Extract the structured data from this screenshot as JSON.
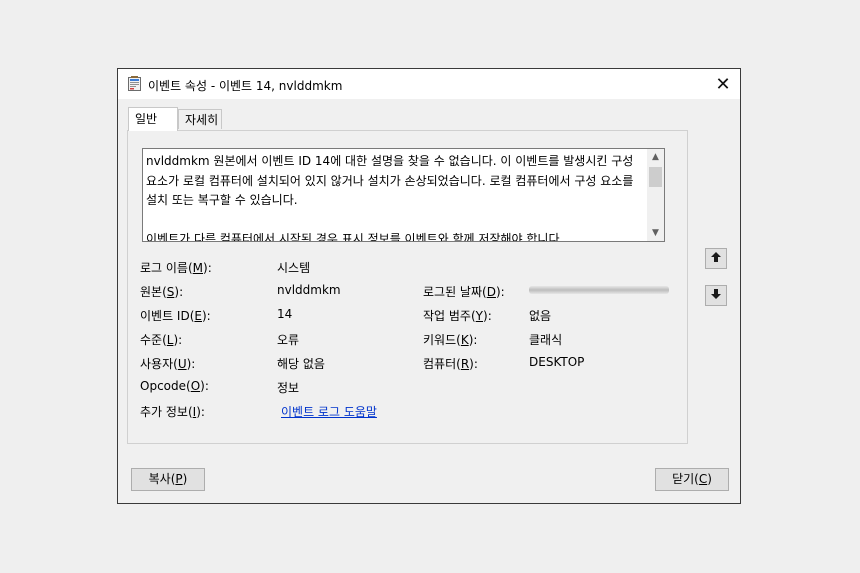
{
  "window": {
    "title": "이벤트 속성 - 이벤트 14, nvlddmkm",
    "close_glyph": "✕"
  },
  "tabs": [
    {
      "label": "일반",
      "active": true
    },
    {
      "label": "자세히",
      "active": false
    }
  ],
  "description": {
    "paragraph1": "nvlddmkm 원본에서 이벤트 ID 14에 대한 설명을 찾을 수 없습니다. 이 이벤트를 발생시킨 구성 요소가 로컬 컴퓨터에 설치되어 있지 않거나 설치가 손상되었습니다. 로컬 컴퓨터에서 구성 요소를 설치 또는 복구할 수 있습니다.",
    "paragraph2": "이벤트가 다른 컴퓨터에서 시작된 경우 표시 정보를 이벤트와 함께 저장해야 합니다."
  },
  "fields": {
    "log_name": {
      "label_pre": "로그 이름(",
      "key": "M",
      "label_post": "):",
      "value": "시스템"
    },
    "source": {
      "label_pre": "원본(",
      "key": "S",
      "label_post": "):",
      "value": "nvlddmkm"
    },
    "logged": {
      "label_pre": "로그된 날짜(",
      "key": "D",
      "label_post": "):"
    },
    "event_id": {
      "label_pre": "이벤트 ID(",
      "key": "E",
      "label_post": "):",
      "value": "14"
    },
    "task_category": {
      "label_pre": "작업 범주(",
      "key": "Y",
      "label_post": "):",
      "value": "없음"
    },
    "level": {
      "label_pre": "수준(",
      "key": "L",
      "label_post": "):",
      "value": "오류"
    },
    "keywords": {
      "label_pre": "키워드(",
      "key": "K",
      "label_post": "):",
      "value": "클래식"
    },
    "user": {
      "label_pre": "사용자(",
      "key": "U",
      "label_post": "):",
      "value": "해당 없음"
    },
    "computer": {
      "label_pre": "컴퓨터(",
      "key": "R",
      "label_post": "):",
      "value": "DESKTOP"
    },
    "opcode": {
      "label_pre": "Opcode(",
      "key": "O",
      "label_post": "):",
      "value": "정보"
    },
    "more_info": {
      "label_pre": "추가 정보(",
      "key": "I",
      "label_post": "):",
      "link": "이벤트 로그 도움말"
    }
  },
  "buttons": {
    "copy": {
      "pre": "복사(",
      "key": "P",
      "post": ")"
    },
    "close": {
      "pre": "닫기(",
      "key": "C",
      "post": ")"
    }
  },
  "icons": {
    "title": "event-properties-icon",
    "nav_up": "up-arrow-icon",
    "nav_down": "down-arrow-icon"
  }
}
